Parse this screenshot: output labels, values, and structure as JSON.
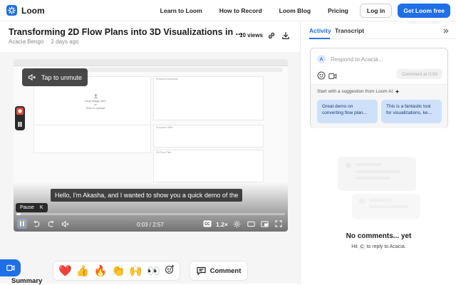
{
  "nav": {
    "brand": "Loom",
    "links": [
      "Learn to Loom",
      "How to Record",
      "Loom Blog",
      "Pricing"
    ],
    "login": "Log in",
    "cta": "Loom free"
  },
  "video": {
    "title": "Transforming 2D Flow Plans into 3D Visualizations in ...",
    "author": "Acacia Bengo",
    "age": "2 days ago",
    "views": "10 views",
    "unmute": "Tap to unmute",
    "caption": "Hello, I'm Akasha, and I wanted to show you a quick demo of the",
    "pause_label": "Pause",
    "pause_key": "K",
    "time": "0:03 / 2:57",
    "speed": "1.2×",
    "progress": 0.017,
    "screen": {
      "drop_title": "Drop image here",
      "drop_or": "or",
      "drop_upload": "Click to Upload",
      "panel1": "Predicted Elements",
      "panel2": "Floorplan Skills",
      "panel3": "3D Floor Plan"
    }
  },
  "reactions": [
    "❤️",
    "👍",
    "🔥",
    "👏",
    "🙌",
    "👀"
  ],
  "comment_button": "Comment",
  "summary_label": "Summary",
  "side": {
    "tab_activity": "Activity",
    "tab_transcript": "Transcript",
    "avatar_initial": "A",
    "reply_placeholder": "Respond to Acacia...",
    "comment_at": "Comment at 0:03",
    "suggest_title": "Start with a suggestion from Loom AI",
    "suggestions": [
      "Great demo on converting flow plan...",
      "This is a fantastic tool for visualizations, ke..."
    ],
    "empty_title": "No comments... yet",
    "hint_prefix": "Hit",
    "hint_key": "C",
    "hint_suffix": "to reply to Acacia."
  },
  "colors": {
    "accent": "#1f6fe6",
    "chip": "#cfe0fb"
  }
}
